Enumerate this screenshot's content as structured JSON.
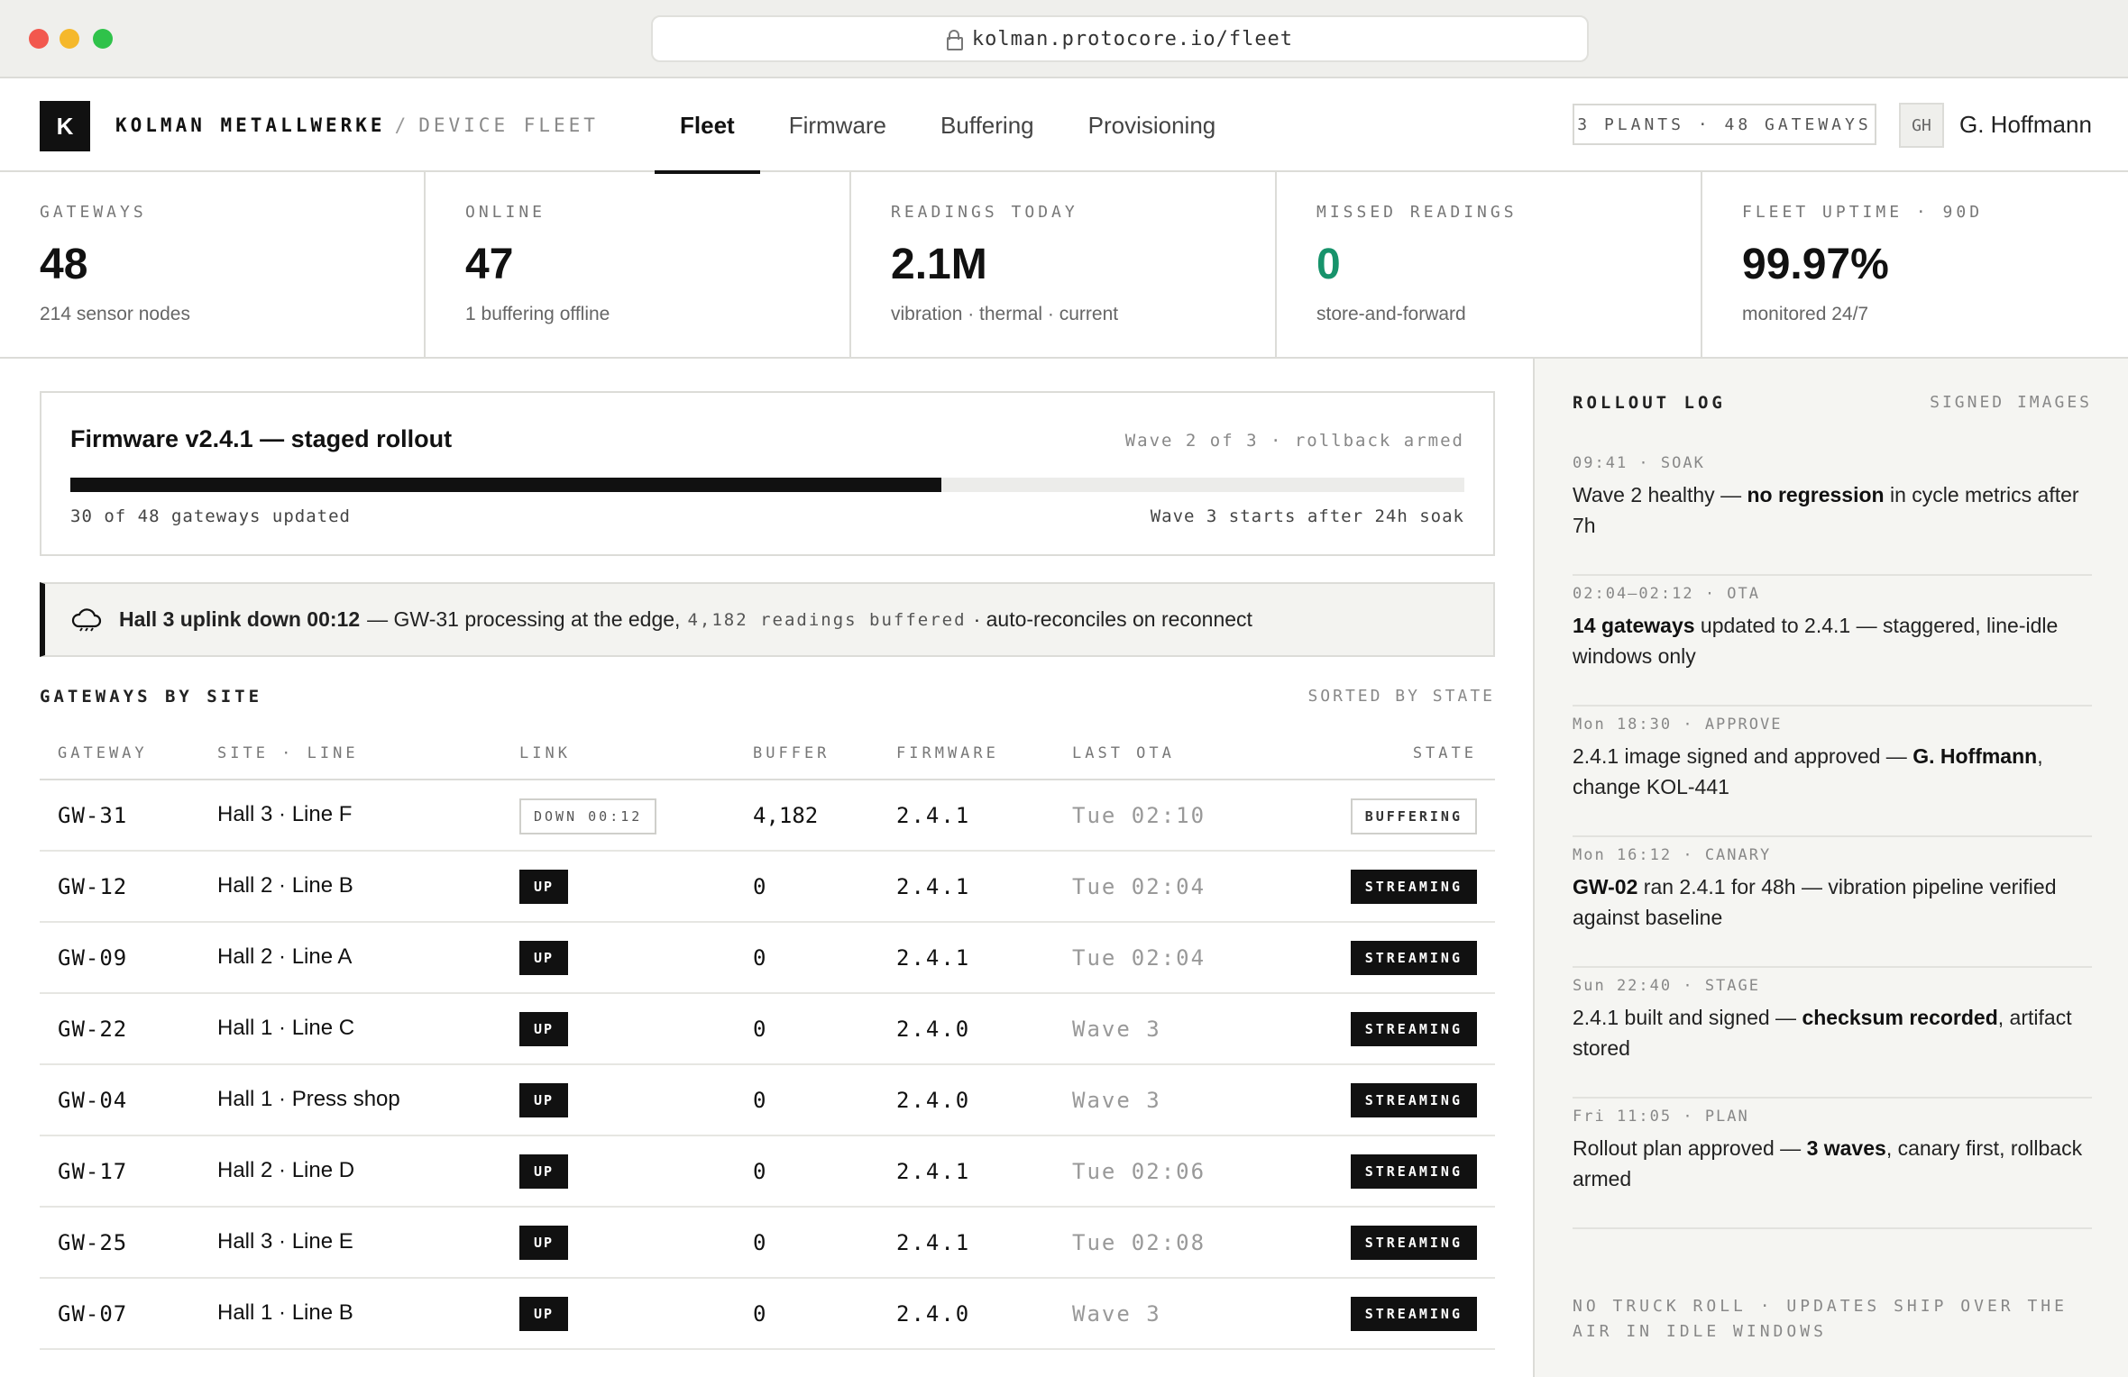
{
  "browser": {
    "url": "kolman.protocore.io/fleet"
  },
  "header": {
    "logo": "K",
    "brand": "KOLMAN METALLWERKE",
    "separator": "/",
    "section": "DEVICE FLEET",
    "tabs": [
      "Fleet",
      "Firmware",
      "Buffering",
      "Provisioning"
    ],
    "active_tab": "Fleet",
    "summary": "3 PLANTS · 48 GATEWAYS",
    "avatar": "GH",
    "user": "G. Hoffmann"
  },
  "stats": [
    {
      "label": "GATEWAYS",
      "value": "48",
      "note": "214 sensor nodes"
    },
    {
      "label": "ONLINE",
      "value": "47",
      "note": "1 buffering offline"
    },
    {
      "label": "READINGS TODAY",
      "value": "2.1M",
      "note": "vibration · thermal · current"
    },
    {
      "label": "MISSED READINGS",
      "value": "0",
      "note": "store-and-forward"
    },
    {
      "label": "FLEET UPTIME · 90D",
      "value": "99.97%",
      "note": "monitored 24/7"
    }
  ],
  "rollout": {
    "title": "Firmware v2.4.1 — staged rollout",
    "meta": "Wave 2 of 3 · rollback armed",
    "progress_fraction": 0.625,
    "updated_note": "30 of 48 gateways updated",
    "next_note": "Wave 3 starts after 24h soak"
  },
  "alert": {
    "icon": "cloud-offline-icon",
    "strong": "Hall 3 uplink down 00:12",
    "text1": "— GW-31 processing at the edge,",
    "buffered": "4,182 readings buffered",
    "text2": "· auto-reconciles on reconnect"
  },
  "gateways": {
    "title": "GATEWAYS BY SITE",
    "sort": "SORTED BY STATE",
    "columns": [
      "GATEWAY",
      "SITE · LINE",
      "LINK",
      "BUFFER",
      "FIRMWARE",
      "LAST OTA",
      "STATE"
    ],
    "rows": [
      {
        "gateway": "GW-31",
        "site": "Hall 3 · Line F",
        "link": "DOWN 00:12",
        "buffer": "4,182",
        "firmware": "2.4.1",
        "last_ota": "Tue 02:10",
        "state": "BUFFERING"
      },
      {
        "gateway": "GW-12",
        "site": "Hall 2 · Line B",
        "link": "UP",
        "buffer": "0",
        "firmware": "2.4.1",
        "last_ota": "Tue 02:04",
        "state": "STREAMING"
      },
      {
        "gateway": "GW-09",
        "site": "Hall 2 · Line A",
        "link": "UP",
        "buffer": "0",
        "firmware": "2.4.1",
        "last_ota": "Tue 02:04",
        "state": "STREAMING"
      },
      {
        "gateway": "GW-22",
        "site": "Hall 1 · Line C",
        "link": "UP",
        "buffer": "0",
        "firmware": "2.4.0",
        "last_ota": "Wave 3",
        "state": "STREAMING"
      },
      {
        "gateway": "GW-04",
        "site": "Hall 1 · Press shop",
        "link": "UP",
        "buffer": "0",
        "firmware": "2.4.0",
        "last_ota": "Wave 3",
        "state": "STREAMING"
      },
      {
        "gateway": "GW-17",
        "site": "Hall 2 · Line D",
        "link": "UP",
        "buffer": "0",
        "firmware": "2.4.1",
        "last_ota": "Tue 02:06",
        "state": "STREAMING"
      },
      {
        "gateway": "GW-25",
        "site": "Hall 3 · Line E",
        "link": "UP",
        "buffer": "0",
        "firmware": "2.4.1",
        "last_ota": "Tue 02:08",
        "state": "STREAMING"
      },
      {
        "gateway": "GW-07",
        "site": "Hall 1 · Line B",
        "link": "UP",
        "buffer": "0",
        "firmware": "2.4.0",
        "last_ota": "Wave 3",
        "state": "STREAMING"
      }
    ]
  },
  "sidebar": {
    "title": "ROLLOUT LOG",
    "subtitle": "SIGNED IMAGES",
    "entries": [
      {
        "when": "09:41 · SOAK",
        "pre": "Wave 2 healthy — ",
        "bold": "no regression",
        "post": " in cycle metrics after 7h"
      },
      {
        "when": "02:04–02:12 · OTA",
        "pre": "",
        "bold": "14 gateways",
        "post": " updated to 2.4.1 — staggered, line-idle windows only"
      },
      {
        "when": "Mon 18:30 · APPROVE",
        "pre": "2.4.1 image signed and approved — ",
        "bold": "G. Hoffmann",
        "post": ", change KOL-441"
      },
      {
        "when": "Mon 16:12 · CANARY",
        "pre": "",
        "bold": "GW-02",
        "post": " ran 2.4.1 for 48h — vibration pipeline verified against baseline"
      },
      {
        "when": "Sun 22:40 · STAGE",
        "pre": "2.4.1 built and signed — ",
        "bold": "checksum recorded",
        "post": ", artifact stored"
      },
      {
        "when": "Fri 11:05 · PLAN",
        "pre": "Rollout plan approved — ",
        "bold": "3 waves",
        "post": ", canary first, rollback armed"
      }
    ],
    "footer": "NO TRUCK ROLL · UPDATES SHIP OVER THE AIR IN IDLE WINDOWS"
  }
}
